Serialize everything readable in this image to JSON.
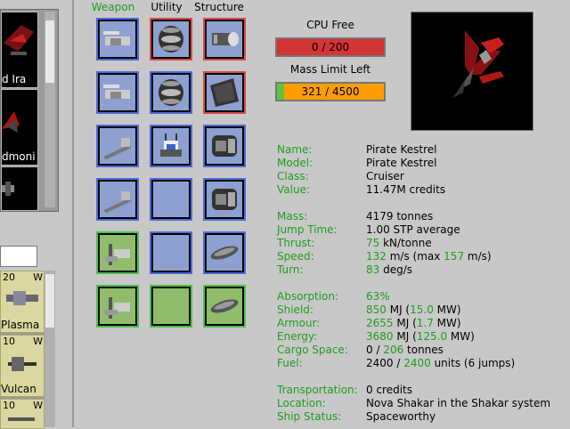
{
  "ship_list": {
    "items": [
      {
        "label": "d Ira"
      },
      {
        "label": "dmoni"
      }
    ]
  },
  "outfit_list": {
    "items": [
      {
        "count": "20",
        "badge": "W",
        "label": "Plasma"
      },
      {
        "count": "10",
        "badge": "W",
        "label": "Vulcan"
      },
      {
        "count": "10",
        "badge": "W",
        "label": ""
      }
    ]
  },
  "columns": {
    "weapon": "Weapon",
    "utility": "Utility",
    "structure": "Structure"
  },
  "cpu": {
    "label": "CPU Free",
    "value": "0 / 200"
  },
  "mass": {
    "label": "Mass Limit Left",
    "value": "321 / 4500",
    "fill_fraction": 0.07
  },
  "stats": {
    "name": {
      "key": "Name:",
      "value": "Pirate Kestrel"
    },
    "model": {
      "key": "Model:",
      "value": "Pirate Kestrel"
    },
    "class": {
      "key": "Class:",
      "value": "Cruiser"
    },
    "value": {
      "key": "Value:",
      "value": "11.47M credits"
    },
    "mass": {
      "key": "Mass:",
      "value": "4179 tonnes"
    },
    "jump": {
      "key": "Jump Time:",
      "value": "1.00 STP average"
    },
    "thrust": {
      "key": "Thrust:",
      "g": "75",
      "rest": " kN/tonne"
    },
    "speed": {
      "key": "Speed:",
      "g1": "132",
      "mid": " m/s (max ",
      "g2": "157",
      "rest": " m/s)"
    },
    "turn": {
      "key": "Turn:",
      "g": "83",
      "rest": " deg/s"
    },
    "absorption": {
      "key": "Absorption:",
      "g": "63%"
    },
    "shield": {
      "key": "Shield:",
      "g1": "850",
      "mid": " MJ (",
      "g2": "15.0",
      "rest": " MW)"
    },
    "armour": {
      "key": "Armour:",
      "g1": "2655",
      "mid": " MJ (",
      "g2": "1.7",
      "rest": " MW)"
    },
    "energy": {
      "key": "Energy:",
      "g1": "3680",
      "mid": " MJ (",
      "g2": "125.0",
      "rest": " MW)"
    },
    "cargo": {
      "key": "Cargo Space:",
      "pre": "0 / ",
      "g": "206",
      "rest": " tonnes"
    },
    "fuel": {
      "key": "Fuel:",
      "pre": "2400 / ",
      "g": "2400",
      "rest": " units (6 jumps)"
    },
    "transport": {
      "key": "Transportation:",
      "value": "0 credits"
    },
    "location": {
      "key": "Location:",
      "value": "Nova Shakar in the Shakar system"
    },
    "status": {
      "key": "Ship Status:",
      "value": "Spaceworthy"
    }
  }
}
